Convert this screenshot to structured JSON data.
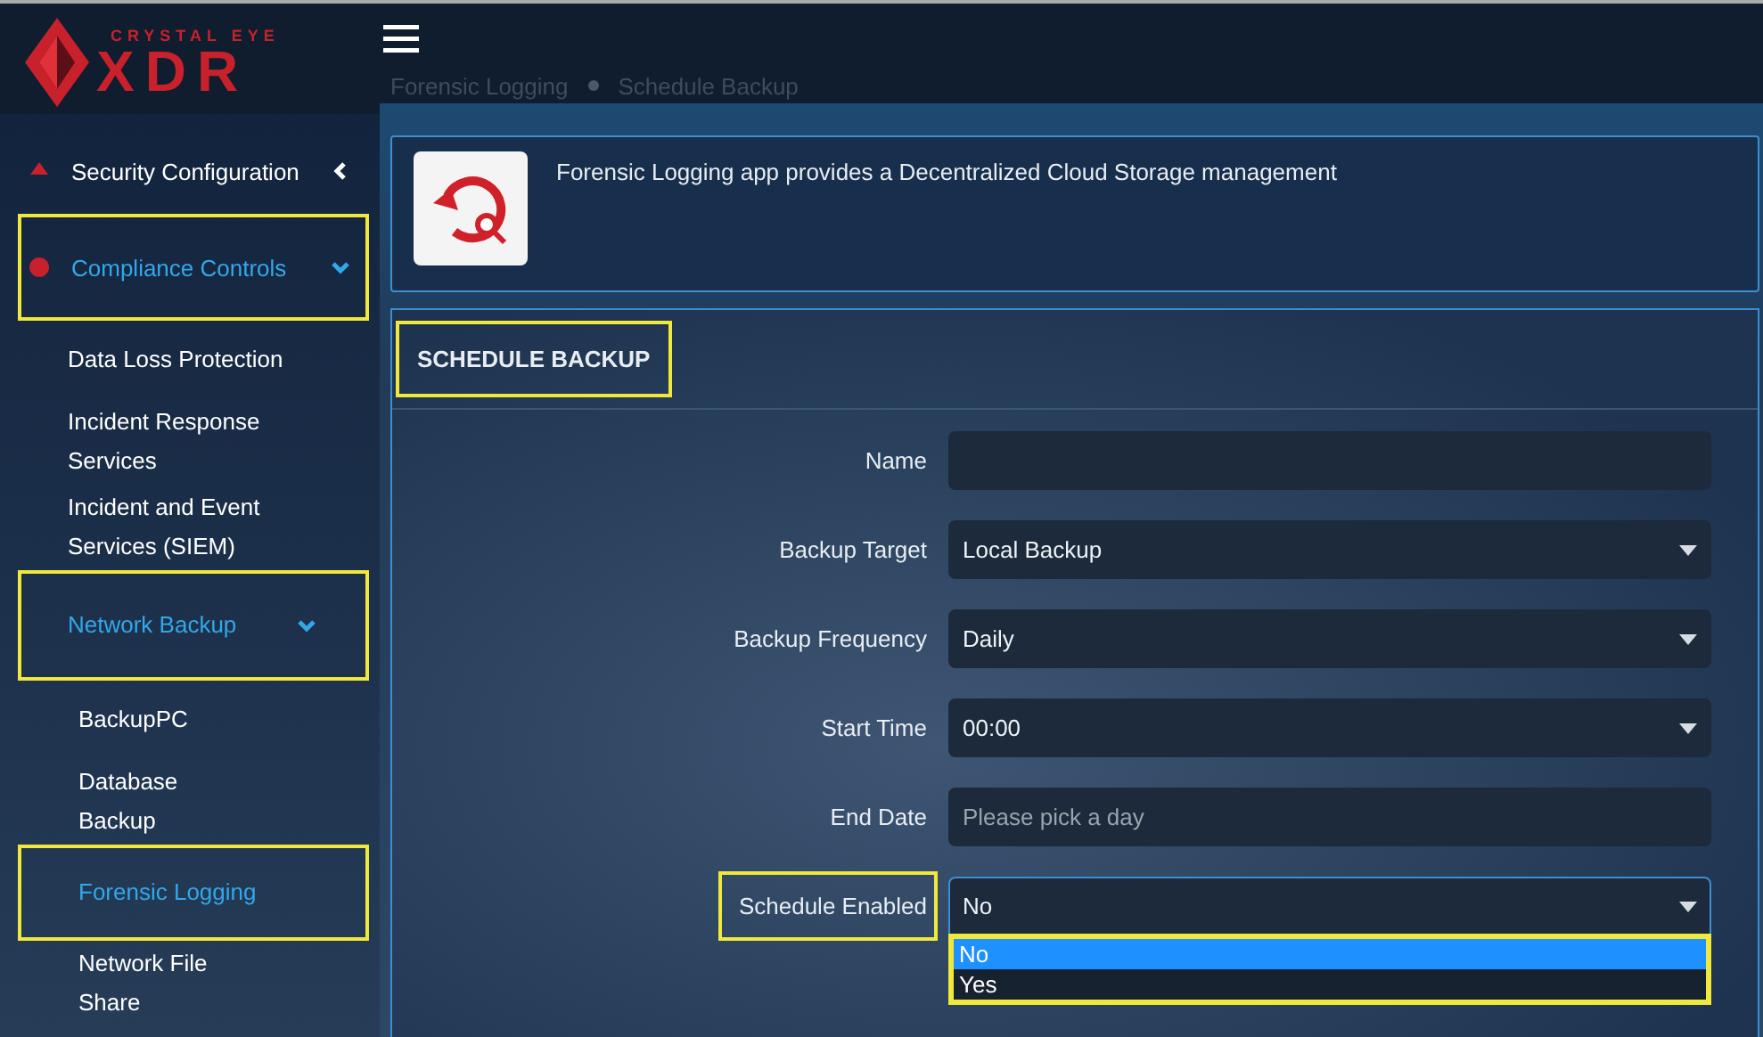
{
  "logo": {
    "tagline": "CRYSTAL EYE",
    "wordmark": "XDR"
  },
  "breadcrumb": [
    "Forensic Logging",
    "Schedule Backup"
  ],
  "sidebar": {
    "items": [
      {
        "label": "Security Configuration",
        "expanded": false,
        "selected": false,
        "highlighted": false
      },
      {
        "label": "Compliance Controls",
        "expanded": true,
        "selected": true,
        "highlighted": true,
        "children": [
          {
            "label": "Data Loss Protection",
            "selected": false,
            "highlighted": false
          },
          {
            "label": "Incident Response Services",
            "selected": false,
            "highlighted": false
          },
          {
            "label": "Incident and Event Services (SIEM)",
            "selected": false,
            "highlighted": false
          },
          {
            "label": "Network Backup",
            "expanded": true,
            "selected": true,
            "highlighted": true,
            "children": [
              {
                "label": "BackupPC",
                "selected": false,
                "highlighted": false
              },
              {
                "label": "Database Backup",
                "selected": false,
                "highlighted": false
              },
              {
                "label": "Forensic Logging",
                "selected": true,
                "highlighted": true
              },
              {
                "label": "Network File Share",
                "selected": false,
                "highlighted": false
              }
            ]
          }
        ]
      }
    ]
  },
  "app_info": {
    "description": "Forensic Logging app provides a Decentralized Cloud Storage management"
  },
  "form": {
    "title": "SCHEDULE BACKUP",
    "title_highlighted": true,
    "fields": [
      {
        "label": "Name",
        "kind": "text",
        "highlighted": false
      },
      {
        "label": "Backup Target",
        "kind": "select",
        "value": "Local Backup",
        "highlighted": false
      },
      {
        "label": "Backup Frequency",
        "kind": "select",
        "value": "Daily",
        "highlighted": false
      },
      {
        "label": "Start Time",
        "kind": "select",
        "value": "00:00",
        "highlighted": false
      },
      {
        "label": "End Date",
        "kind": "date",
        "placeholder": "Please pick a day",
        "highlighted": false
      },
      {
        "label": "Schedule Enabled",
        "kind": "select",
        "value": "No",
        "highlighted": true,
        "open": true,
        "options_highlighted": true,
        "options": [
          {
            "label": "No",
            "selected": true
          },
          {
            "label": "Yes",
            "selected": false
          }
        ]
      }
    ]
  }
}
